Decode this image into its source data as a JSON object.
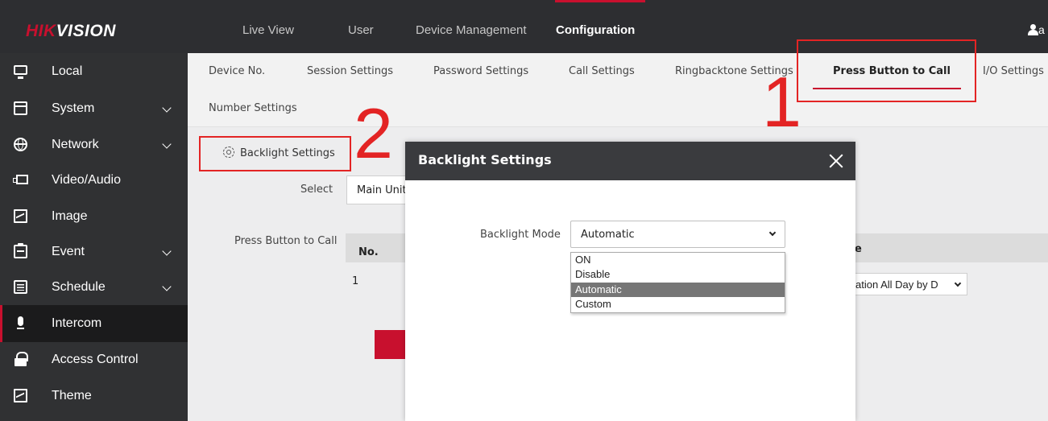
{
  "brand": {
    "logo_hik": "HIK",
    "logo_vision": "VISION",
    "accent": "#c8102e"
  },
  "top_nav": {
    "items": [
      "Live View",
      "User",
      "Device Management",
      "Configuration"
    ],
    "active": "Configuration",
    "user_initial": "a"
  },
  "sidebar": {
    "items": [
      {
        "label": "Local",
        "icon": "monitor-icon",
        "expandable": false
      },
      {
        "label": "System",
        "icon": "window-icon",
        "expandable": true
      },
      {
        "label": "Network",
        "icon": "globe-icon",
        "expandable": true
      },
      {
        "label": "Video/Audio",
        "icon": "video-icon",
        "expandable": false
      },
      {
        "label": "Image",
        "icon": "image-icon",
        "expandable": false
      },
      {
        "label": "Event",
        "icon": "clipboard-icon",
        "expandable": true
      },
      {
        "label": "Schedule",
        "icon": "schedule-icon",
        "expandable": true
      },
      {
        "label": "Intercom",
        "icon": "microphone-icon",
        "expandable": false,
        "active": true
      },
      {
        "label": "Access Control",
        "icon": "lock-icon",
        "expandable": false
      },
      {
        "label": "Theme",
        "icon": "image-icon",
        "expandable": false
      }
    ]
  },
  "tabs": {
    "items": [
      "Device No.",
      "Session Settings",
      "Password Settings",
      "Call Settings",
      "Ringbacktone Settings",
      "Press Button to Call",
      "I/O Settings",
      "Number Settings"
    ],
    "active": "Press Button to Call"
  },
  "page": {
    "backlight_link": "Backlight Settings",
    "select_label": "Select",
    "select_value": "Main Unit",
    "press_button_label": "Press Button to Call",
    "table_header_no": "No.",
    "table_header_partial": "e",
    "row_no": "1",
    "row_select_value": "ation All Day by D"
  },
  "annotations": {
    "num1": "1",
    "num2": "2",
    "color": "#e32424"
  },
  "modal": {
    "title": "Backlight Settings",
    "field_label": "Backlight Mode",
    "field_value": "Automatic",
    "options": [
      "ON",
      "Disable",
      "Automatic",
      "Custom"
    ],
    "selected_option": "Automatic"
  }
}
